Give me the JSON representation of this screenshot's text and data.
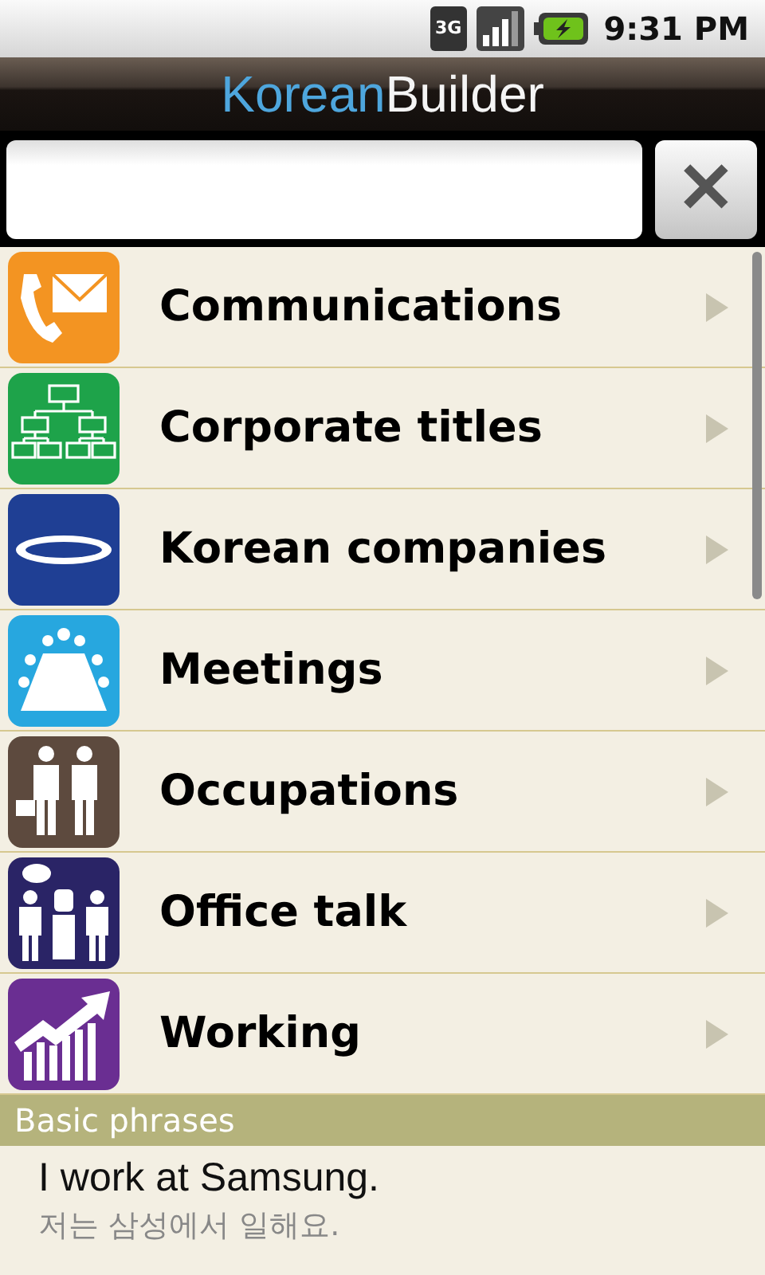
{
  "status_bar": {
    "network": "3G",
    "time": "9:31 PM"
  },
  "app_title": {
    "part_1": "Korean",
    "part_2": "Builder"
  },
  "search": {
    "clear_label": "✕"
  },
  "categories": [
    {
      "label": "Communications",
      "kind": "phone-mail",
      "color": "#f39422"
    },
    {
      "label": "Corporate titles",
      "kind": "org-chart",
      "color": "#1ea34a"
    },
    {
      "label": "Korean companies",
      "kind": "logo",
      "color": "#1f3f94"
    },
    {
      "label": "Meetings",
      "kind": "meeting",
      "color": "#27a7df"
    },
    {
      "label": "Occupations",
      "kind": "workers",
      "color": "#5d4a3e"
    },
    {
      "label": "Office talk",
      "kind": "cooler",
      "color": "#2a2466"
    },
    {
      "label": "Working",
      "kind": "growth",
      "color": "#6a2e92"
    }
  ],
  "section": {
    "title": "Basic phrases"
  },
  "phrase": {
    "english": "I work at Samsung.",
    "korean": "저는 삼성에서 일해요."
  }
}
